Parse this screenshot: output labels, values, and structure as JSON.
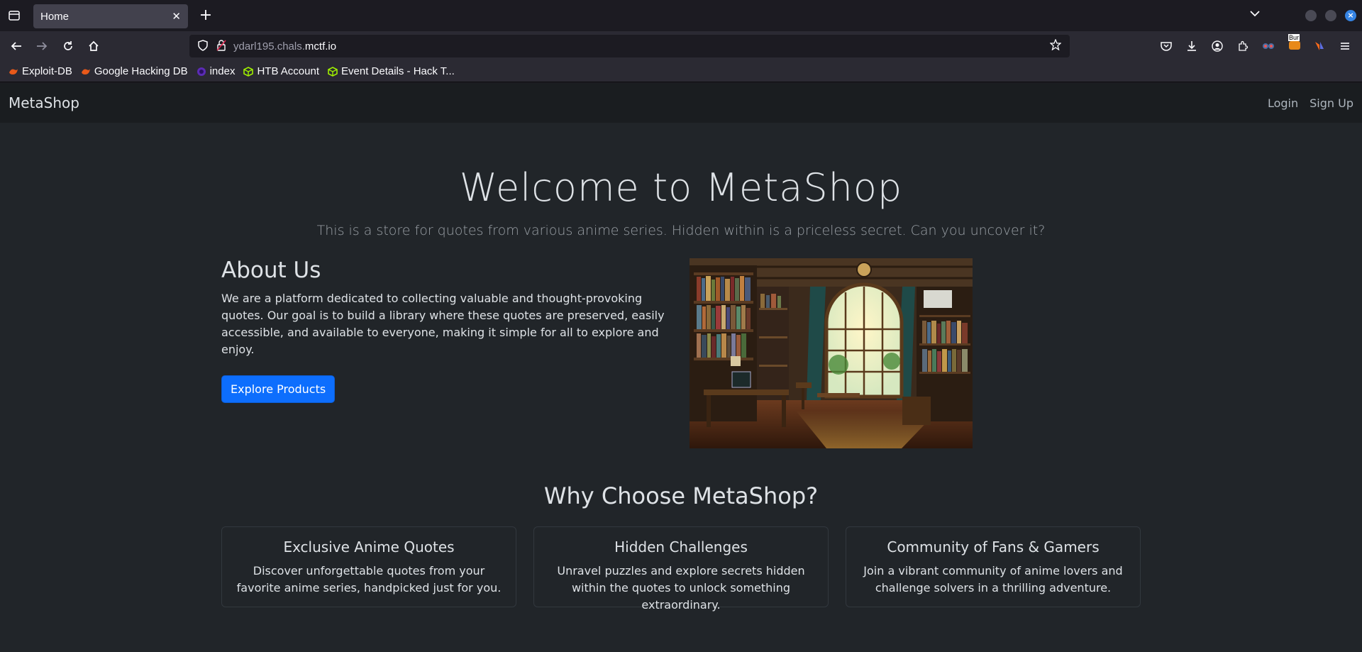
{
  "browser": {
    "tab": {
      "title": "Home",
      "close": "✕"
    },
    "new_tab": "+",
    "url": {
      "prefix": "ydarl195.chals.",
      "domain": "mctf.io"
    },
    "bookmarks": [
      {
        "label": "Exploit-DB",
        "icon": "exploit-db-icon",
        "color": "#e8591a"
      },
      {
        "label": "Google Hacking DB",
        "icon": "exploit-db-icon",
        "color": "#e8591a"
      },
      {
        "label": "index",
        "icon": "circle-icon",
        "color": "#5b2bb5"
      },
      {
        "label": "HTB Account",
        "icon": "htb-cube-icon",
        "color": "#9fef00"
      },
      {
        "label": "Event Details - Hack T...",
        "icon": "htb-cube-icon",
        "color": "#9fef00"
      }
    ],
    "extension_badge": "Bur"
  },
  "site": {
    "brand": "MetaShop",
    "nav_links": {
      "login": "Login",
      "signup": "Sign Up"
    },
    "hero": {
      "title": "Welcome to MetaShop",
      "subtitle": "This is a store for quotes from various anime series. Hidden within is a priceless secret. Can you uncover it?"
    },
    "about": {
      "heading": "About Us",
      "body": "We are a platform dedicated to collecting valuable and thought-provoking quotes. Our goal is to build a library where these quotes are preserved, easily accessible, and available to everyone, making it simple for all to explore and enjoy.",
      "button": "Explore Products"
    },
    "why": {
      "heading": "Why Choose MetaShop?",
      "cards": [
        {
          "title": "Exclusive Anime Quotes",
          "text": "Discover unforgettable quotes from your favorite anime series, handpicked just for you."
        },
        {
          "title": "Hidden Challenges",
          "text": "Unravel puzzles and explore secrets hidden within the quotes to unlock something extraordinary."
        },
        {
          "title": "Community of Fans & Gamers",
          "text": "Join a vibrant community of anime lovers and challenge solvers in a thrilling adventure."
        }
      ]
    },
    "colors": {
      "primary": "#0d6efd",
      "background": "#212529",
      "navbar": "#1a1d20"
    }
  }
}
